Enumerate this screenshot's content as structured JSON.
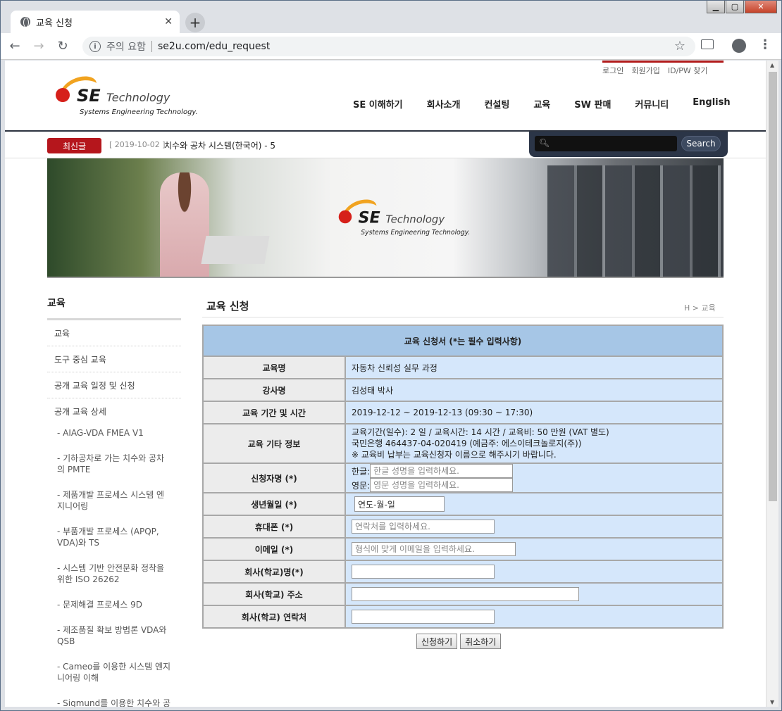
{
  "browser": {
    "tab_title": "교육 신청",
    "security_text": "주의 요함",
    "url": "se2u.com/edu_request"
  },
  "site": {
    "top_menu": [
      "로그인",
      "회원가입",
      "ID/PW 찾기"
    ],
    "logo_main": "SE Technology",
    "logo_sub": "Systems Engineering Technology.",
    "nav": [
      "SE 이해하기",
      "회사소개",
      "컨설팅",
      "교육",
      "SW 판매",
      "커뮤니티",
      "English"
    ],
    "news_badge": "최신글",
    "news_date": "[ 2019-10-02 ]",
    "news_title": "치수와 공차 시스템(한국어) - 5",
    "search_label": "Search",
    "accent_color": "#b5161c"
  },
  "sidebar": {
    "title": "교육",
    "items": [
      "교육",
      "도구 중심 교육",
      "공개 교육 일정 및 신청",
      "공개 교육 상세"
    ],
    "subitems": [
      "- AIAG-VDA FMEA V1",
      "- 기하공차로 가는 치수와 공차의 PMTE",
      "- 제품개발 프로세스 시스템 엔지니어링",
      "- 부품개발 프로세스 (APQP, VDA)와 TS",
      "- 시스템 기반 안전문화 정착을 위한 ISO 26262",
      "- 문제해결 프로세스 9D",
      "- 제조품질 확보 방법론 VDA와 QSB",
      "- Cameo를 이용한 시스템 엔지니어링 이해",
      "- Sigmund를 이용한 치수와 공"
    ]
  },
  "content": {
    "title": "교육 신청",
    "breadcrumb": "H > 교육",
    "form_caption": "교육 신청서 (*는 필수 입력사항)",
    "rows": {
      "course_label": "교육명",
      "course_value": "자동차 신뢰성 실무 과정",
      "instructor_label": "강사명",
      "instructor_value": "김성태 박사",
      "period_label": "교육 기간 및 시간",
      "period_value": "2019-12-12 ~ 2019-12-13 (09:30 ~ 17:30)",
      "etc_label": "교육 기타 정보",
      "etc_line1": "교육기간(일수): 2 일 / 교육시간: 14 시간 / 교육비: 50 만원 (VAT 별도)",
      "etc_line2": "국민은행 464437-04-020419 (예금주: 에스이테크놀로지(주))",
      "etc_line3": "※ 교육비 납부는 교육신청자 이름으로 해주시기 바랍니다.",
      "name_label": "신청자명 (*)",
      "name_kr_prefix": "한글:",
      "name_kr_placeholder": "한글 성명을 입력하세요.",
      "name_en_prefix": "영문:",
      "name_en_placeholder": "영문 성명을 입력하세요.",
      "birth_label": "생년월일 (*)",
      "birth_value": "연도-월-일",
      "phone_label": "휴대폰 (*)",
      "phone_placeholder": "연락처를 입력하세요.",
      "email_label": "이메일 (*)",
      "email_placeholder": "형식에 맞게 이메일을 입력하세요.",
      "company_label": "회사(학교)명(*)",
      "address_label": "회사(학교) 주소",
      "contact_label": "회사(학교) 연락처"
    },
    "submit_label": "신청하기",
    "cancel_label": "취소하기"
  }
}
